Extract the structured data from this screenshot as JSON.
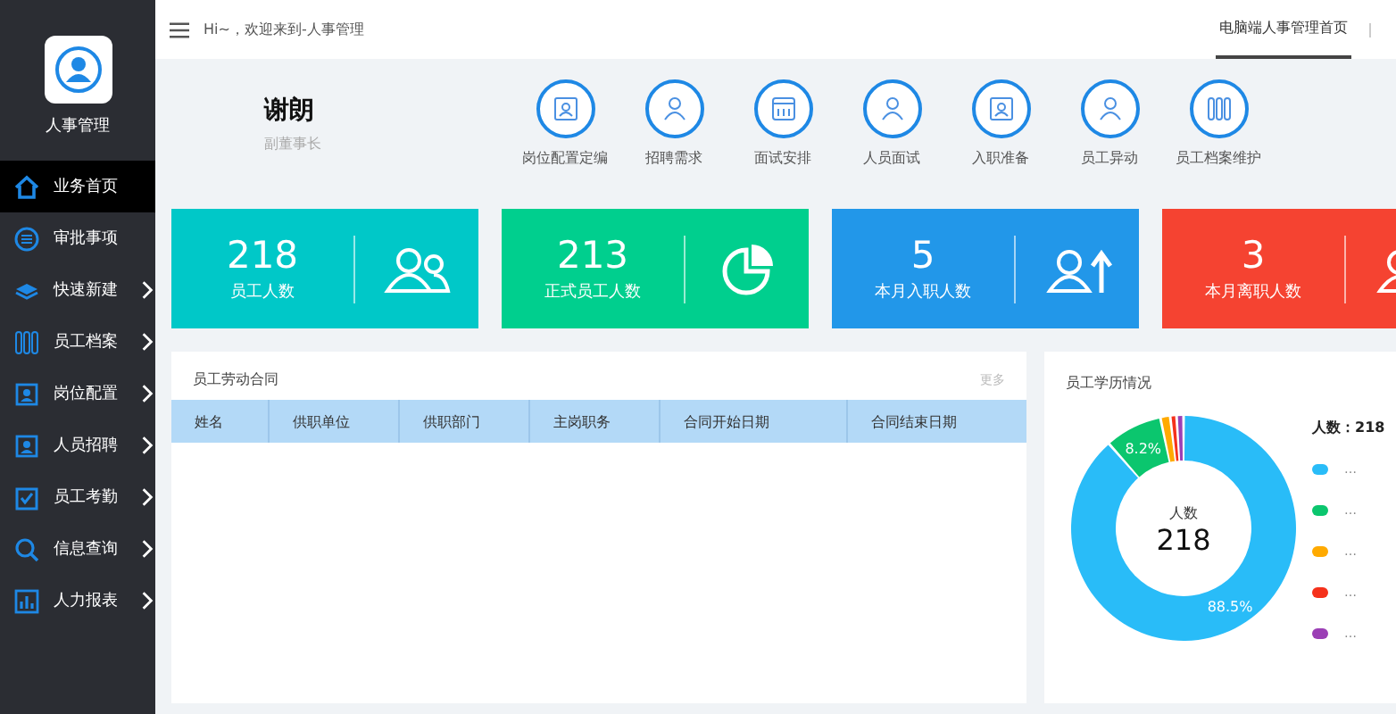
{
  "sidebar": {
    "logo_label": "人事管理",
    "items": [
      {
        "label": "业务首页",
        "selected": true,
        "has_children": false
      },
      {
        "label": "审批事项",
        "selected": false,
        "has_children": false
      },
      {
        "label": "快速新建",
        "selected": false,
        "has_children": true
      },
      {
        "label": "员工档案",
        "selected": false,
        "has_children": true
      },
      {
        "label": "岗位配置",
        "selected": false,
        "has_children": true
      },
      {
        "label": "人员招聘",
        "selected": false,
        "has_children": true
      },
      {
        "label": "员工考勤",
        "selected": false,
        "has_children": true
      },
      {
        "label": "信息查询",
        "selected": false,
        "has_children": true
      },
      {
        "label": "人力报表",
        "selected": false,
        "has_children": true
      }
    ]
  },
  "header": {
    "greeting": "Hi~，欢迎来到-人事管理",
    "tabs": [
      {
        "label": "电脑端人事管理首页",
        "selected": true
      }
    ]
  },
  "profile": {
    "name": "谢朗",
    "title": "副董事长"
  },
  "shortcuts": [
    "岗位配置定编",
    "招聘需求",
    "面试安排",
    "人员面试",
    "入职准备",
    "员工异动",
    "员工档案维护"
  ],
  "stats": [
    {
      "value": "218",
      "label": "员工人数",
      "color": "#00c8c8"
    },
    {
      "value": "213",
      "label": "正式员工人数",
      "color": "#00cf8e"
    },
    {
      "value": "5",
      "label": "本月入职人数",
      "color": "#2297e9"
    },
    {
      "value": "3",
      "label": "本月离职人数",
      "color": "#f54331"
    }
  ],
  "contracts": {
    "title": "员工劳动合同",
    "more": "更多",
    "columns": [
      "姓名",
      "供职单位",
      "供职部门",
      "主岗职务",
      "合同开始日期",
      "合同结束日期"
    ]
  },
  "education": {
    "title": "员工学历情况",
    "center_value": "218",
    "legend_title": "人数：218",
    "legend": [
      {
        "color": "#29bcf8"
      },
      {
        "color": "#0bc66e"
      },
      {
        "color": "#ffaa00"
      },
      {
        "color": "#f5311b"
      },
      {
        "color": "#9b3fb5"
      }
    ],
    "chart_data": {
      "type": "donut",
      "categories": [
        "…",
        "…",
        "…",
        "…",
        "…"
      ],
      "series": [
        {
          "name": "人数",
          "values": [
            88.5,
            8.2,
            1.4,
            0.9,
            1.0
          ]
        }
      ],
      "value_labels": [
        "88.5%",
        "8.2%",
        null,
        null,
        null
      ]
    }
  }
}
